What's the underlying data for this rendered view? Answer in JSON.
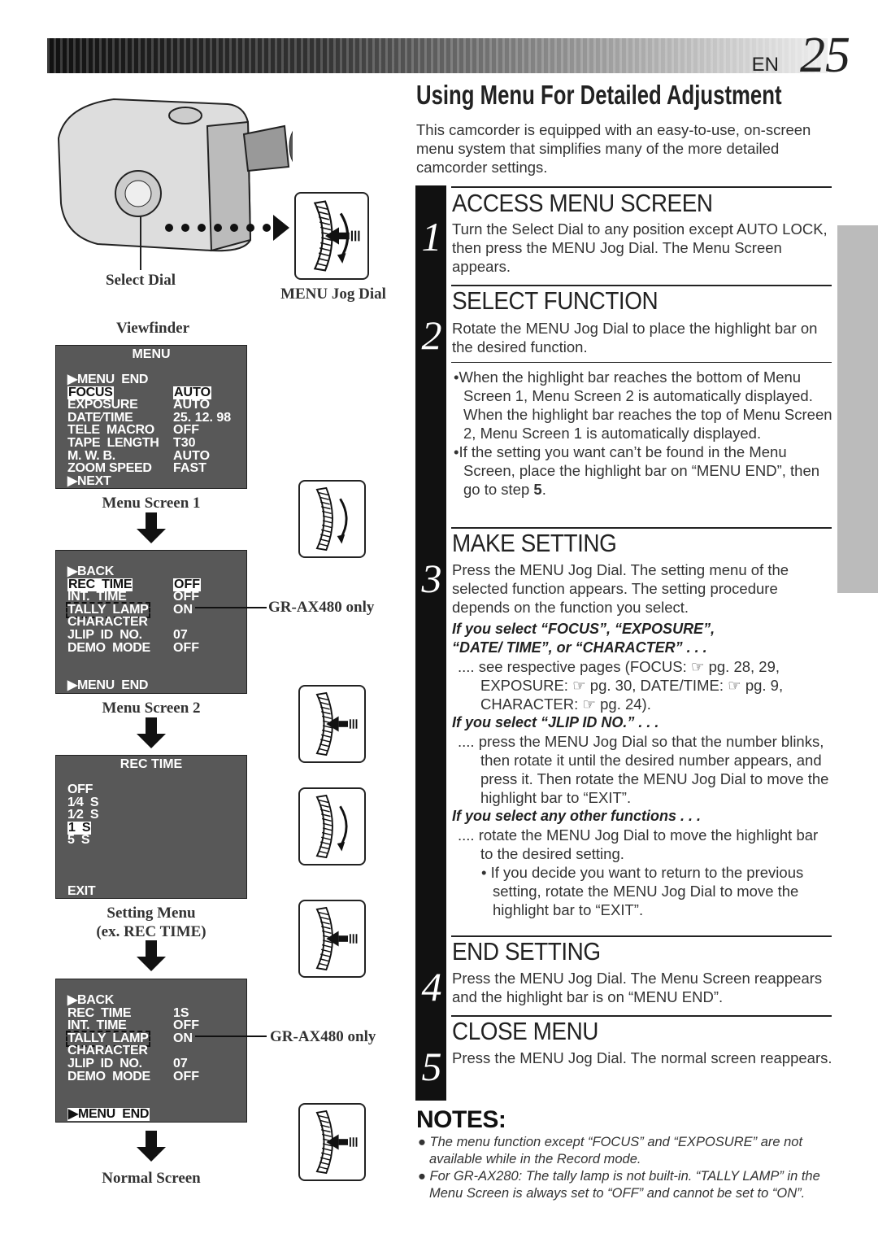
{
  "header": {
    "lang": "EN",
    "page": "25"
  },
  "title": "Using Menu For Detailed Adjustment",
  "intro": "This camcorder is equipped with an easy-to-use, on-screen menu system that simplifies many of the more detailed camcorder settings.",
  "figure": {
    "select_dial": "Select Dial",
    "menu_jog_dial": "MENU Jog Dial",
    "viewfinder": "Viewfinder",
    "menu_screen_1": "Menu Screen 1",
    "menu_screen_2": "Menu Screen 2",
    "setting_menu": "Setting Menu",
    "setting_menu_ex": "(ex. REC TIME)",
    "normal_screen": "Normal Screen",
    "gr_only": "GR-AX480 only",
    "menus": [
      {
        "title": "MENU",
        "rows": [
          {
            "label": "▶MENU  END",
            "value": ""
          },
          {
            "label": "FOCUS",
            "value": "AUTO",
            "hl": true,
            "blink": true
          },
          {
            "label": "EXPOSURE",
            "value": "AUTO"
          },
          {
            "label": "DATE⁄TIME",
            "value": "25. 12. 98"
          },
          {
            "label": "TELE  MACRO",
            "value": "OFF"
          },
          {
            "label": "TAPE  LENGTH",
            "value": "T30"
          },
          {
            "label": "M. W. B.",
            "value": "AUTO"
          },
          {
            "label": "ZOOM SPEED",
            "value": "FAST"
          },
          {
            "label": "▶NEXT",
            "value": ""
          }
        ]
      },
      {
        "title": "",
        "rows": [
          {
            "label": "▶BACK",
            "value": ""
          },
          {
            "label": "REC  TIME",
            "value": "OFF",
            "hl": true,
            "blink": true
          },
          {
            "label": "INT.  TIME",
            "value": "OFF"
          },
          {
            "label": "TALLY  LAMP",
            "value": "ON",
            "dash": true
          },
          {
            "label": "CHARACTER",
            "value": ""
          },
          {
            "label": "JLIP  ID  NO.",
            "value": "07"
          },
          {
            "label": "DEMO  MODE",
            "value": "OFF"
          },
          {
            "label": "",
            "value": ""
          },
          {
            "label": "",
            "value": ""
          },
          {
            "label": "▶MENU  END",
            "value": ""
          }
        ]
      },
      {
        "title": "REC  TIME",
        "rows": [
          {
            "label": "OFF",
            "value": ""
          },
          {
            "label": "1⁄4  S",
            "value": ""
          },
          {
            "label": "1⁄2  S",
            "value": ""
          },
          {
            "label": "1  S",
            "value": "",
            "hl": true
          },
          {
            "label": "5  S",
            "value": ""
          },
          {
            "label": "",
            "value": ""
          },
          {
            "label": "",
            "value": ""
          },
          {
            "label": "",
            "value": ""
          },
          {
            "label": "EXIT",
            "value": ""
          }
        ]
      },
      {
        "title": "",
        "rows": [
          {
            "label": "▶BACK",
            "value": ""
          },
          {
            "label": "REC  TIME",
            "value": "1S"
          },
          {
            "label": "INT.  TIME",
            "value": "OFF"
          },
          {
            "label": "TALLY  LAMP",
            "value": "ON",
            "dash": true
          },
          {
            "label": "CHARACTER",
            "value": ""
          },
          {
            "label": "JLIP  ID  NO.",
            "value": "07"
          },
          {
            "label": "DEMO  MODE",
            "value": "OFF"
          },
          {
            "label": "",
            "value": ""
          },
          {
            "label": "",
            "value": ""
          },
          {
            "label": "▶MENU  END",
            "value": "",
            "hl": true
          }
        ]
      }
    ]
  },
  "steps": [
    {
      "num": "1",
      "heading": "ACCESS MENU SCREEN",
      "body": "Turn the Select Dial to any position except AUTO LOCK, then press the MENU Jog Dial. The Menu Screen appears."
    },
    {
      "num": "2",
      "heading": "SELECT FUNCTION",
      "body": "Rotate the MENU Jog Dial to place the highlight bar on the desired function.",
      "bullets": [
        "•When the highlight bar reaches the bottom of Menu Screen 1, Menu Screen 2 is automatically displayed. When the highlight bar reaches the top of Menu Screen 2, Menu Screen 1 is automatically displayed.",
        "•If the setting you want can’t be found in the Menu Screen, place the highlight bar on “MENU END”, then go to step ",
        "5",
        "."
      ]
    },
    {
      "num": "3",
      "heading": "MAKE SETTING",
      "body": "Press the MENU Jog Dial. The setting menu of the selected function appears. The setting procedure depends on the function you select.",
      "subs": [
        {
          "heading": "If you select “FOCUS”, “EXPOSURE”, “DATE/ TIME”, or “CHARACTER” . . .",
          "body": ".... see respective pages (FOCUS: ☞ pg. 28, 29, EXPOSURE: ☞ pg. 30, DATE/TIME: ☞ pg. 9, CHARACTER: ☞ pg. 24)."
        },
        {
          "heading": "If you select “JLIP ID NO.” . . .",
          "body": ".... press the MENU Jog Dial so that the number blinks, then rotate it until the desired number appears, and press it. Then rotate the MENU Jog Dial to move the highlight bar to “EXIT”."
        },
        {
          "heading": "If you select any other functions . . .",
          "body": ".... rotate the MENU Jog Dial to move the highlight bar to the desired setting.",
          "bullet": "• If you decide you want to return to the previous setting, rotate the MENU Jog Dial to move the highlight bar to “EXIT”."
        }
      ]
    },
    {
      "num": "4",
      "heading": "END SETTING",
      "body": "Press the MENU Jog Dial. The Menu Screen reappears and the highlight bar is on “MENU END”."
    },
    {
      "num": "5",
      "heading": "CLOSE MENU",
      "body": "Press the MENU Jog Dial. The normal screen reappears."
    }
  ],
  "notes": {
    "heading": "NOTES:",
    "items": [
      "● The menu function except “FOCUS” and “EXPOSURE” are not available while in the Record mode.",
      "● For GR-AX280: The tally lamp is not built-in. “TALLY LAMP” in the Menu Screen is always set to “OFF” and cannot be set to “ON”."
    ]
  }
}
